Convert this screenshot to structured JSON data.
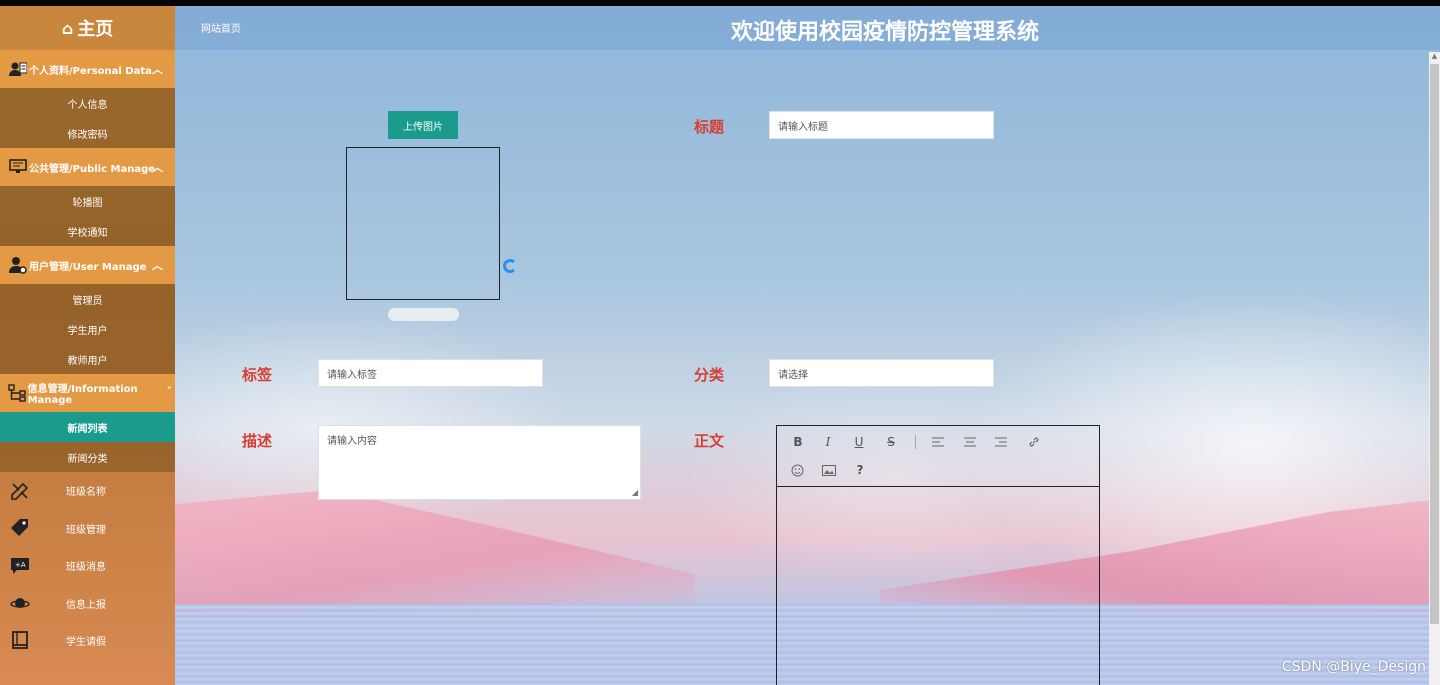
{
  "sidebar": {
    "home_label": "主页",
    "groups": [
      {
        "label": "个人资料/Personal Data",
        "items": [
          "个人信息",
          "修改密码"
        ]
      },
      {
        "label": "公共管理/Public Manage",
        "items": [
          "轮播图",
          "学校通知"
        ]
      },
      {
        "label": "用户管理/User Manage",
        "items": [
          "管理员",
          "学生用户",
          "教师用户"
        ]
      },
      {
        "label": "信息管理/Information Manage",
        "items": [
          "新闻列表",
          "新闻分类"
        ]
      }
    ],
    "active_item": "新闻列表",
    "icon_items": [
      {
        "label": "班级名称",
        "icon": "pencil-ruler-icon"
      },
      {
        "label": "班级管理",
        "icon": "tag-icon"
      },
      {
        "label": "班级消息",
        "icon": "message-icon"
      },
      {
        "label": "信息上报",
        "icon": "planet-icon"
      },
      {
        "label": "学生请假",
        "icon": "book-icon"
      }
    ]
  },
  "header": {
    "home_link": "网站首页",
    "title": "欢迎使用校园疫情防控管理系统"
  },
  "form": {
    "upload_button": "上传图片",
    "title_label": "标题",
    "title_placeholder": "请输入标题",
    "tags_label": "标签",
    "tags_placeholder": "请输入标签",
    "category_label": "分类",
    "category_placeholder": "请选择",
    "description_label": "描述",
    "description_placeholder": "请输入内容",
    "content_label": "正文"
  },
  "editor_toolbar": {
    "bold": "B",
    "italic": "I",
    "underline": "U",
    "strike": "S",
    "help": "?"
  },
  "watermark": "CSDN @Biye_Design"
}
